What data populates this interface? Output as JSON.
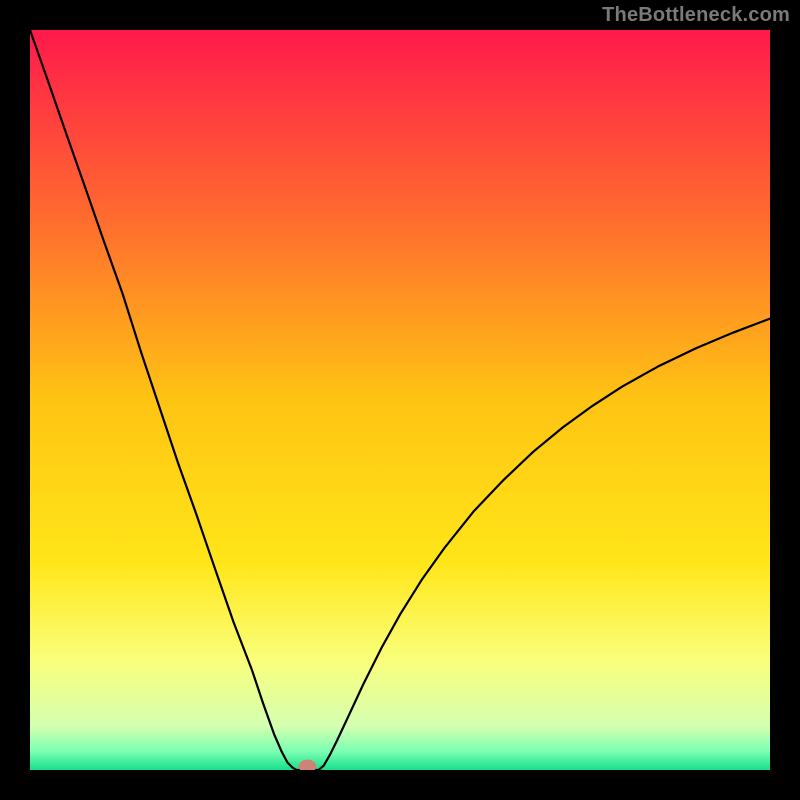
{
  "watermark": "TheBottleneck.com",
  "chart_data": {
    "type": "line",
    "title": "",
    "xlabel": "",
    "ylabel": "",
    "xlim": [
      0,
      100
    ],
    "ylim": [
      0,
      100
    ],
    "grid": false,
    "legend": false,
    "background": {
      "kind": "vertical-gradient",
      "stops": [
        {
          "pos": 0.0,
          "color": "#ff1a4b"
        },
        {
          "pos": 0.25,
          "color": "#ff6a2f"
        },
        {
          "pos": 0.5,
          "color": "#ffc413"
        },
        {
          "pos": 0.72,
          "color": "#ffe619"
        },
        {
          "pos": 0.85,
          "color": "#faff7a"
        },
        {
          "pos": 0.94,
          "color": "#d5ffb0"
        },
        {
          "pos": 0.975,
          "color": "#7bffb2"
        },
        {
          "pos": 1.0,
          "color": "#17e08e"
        }
      ]
    },
    "series": [
      {
        "name": "left-branch",
        "x": [
          0.0,
          2.5,
          5.0,
          7.5,
          10.0,
          12.5,
          15.0,
          17.5,
          20.0,
          22.5,
          25.0,
          27.5,
          30.0,
          31.5,
          33.0,
          34.0,
          34.8,
          35.5,
          36.0
        ],
        "y": [
          100.0,
          92.9,
          85.7,
          78.6,
          71.4,
          64.4,
          56.5,
          49.0,
          41.5,
          34.5,
          27.2,
          20.0,
          13.5,
          9.0,
          4.8,
          2.5,
          1.0,
          0.3,
          0.0
        ]
      },
      {
        "name": "valley",
        "x": [
          36.0,
          36.8,
          37.5,
          38.2,
          39.0
        ],
        "y": [
          0.0,
          0.0,
          0.0,
          0.0,
          0.0
        ]
      },
      {
        "name": "right-branch",
        "x": [
          39.0,
          39.7,
          40.5,
          41.5,
          43.0,
          45.0,
          47.5,
          50.0,
          53.0,
          56.0,
          60.0,
          64.0,
          68.0,
          72.0,
          76.0,
          80.0,
          85.0,
          90.0,
          95.0,
          100.0
        ],
        "y": [
          0.0,
          0.6,
          2.0,
          4.0,
          7.2,
          11.5,
          16.5,
          21.0,
          25.8,
          30.0,
          35.0,
          39.2,
          43.0,
          46.3,
          49.2,
          51.8,
          54.6,
          57.0,
          59.1,
          61.0
        ]
      }
    ],
    "marker": {
      "x": 37.5,
      "y": 0.5,
      "color": "#d18277",
      "rx": 1.2,
      "ry": 0.9
    }
  }
}
